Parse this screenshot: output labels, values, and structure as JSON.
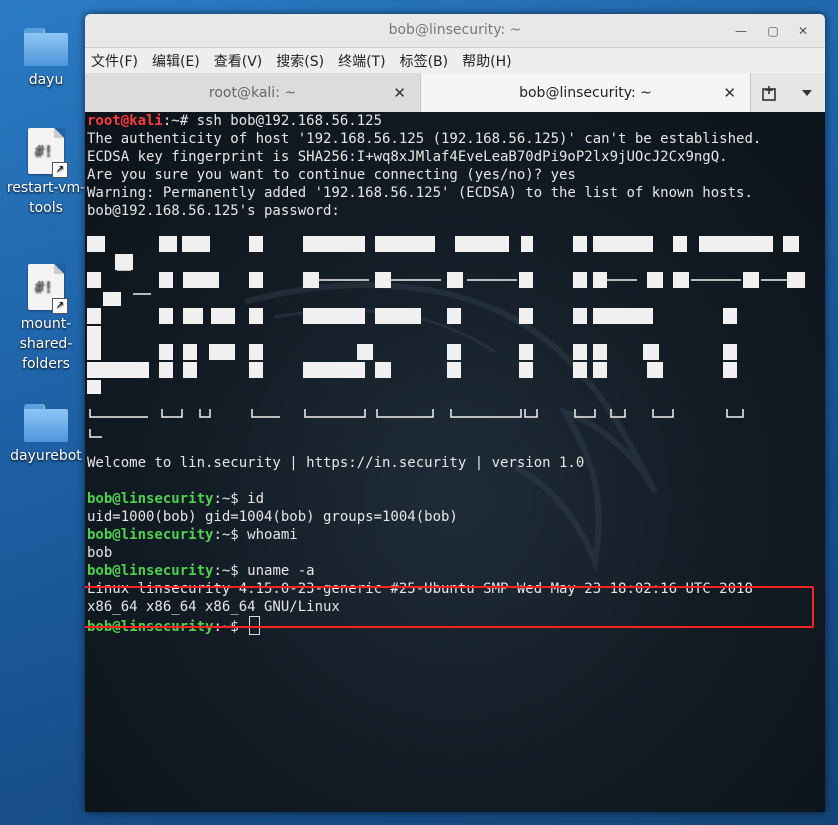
{
  "desktop": {
    "icons": [
      {
        "label": "dayu",
        "kind": "folder-icon"
      },
      {
        "label": "restart-vm-tools",
        "kind": "script-icon"
      },
      {
        "label": "mount-shared-folders",
        "kind": "script-icon"
      },
      {
        "label": "dayurebot",
        "kind": "folder-icon"
      }
    ]
  },
  "window": {
    "title": "bob@linsecurity: ~",
    "menu": [
      "文件(F)",
      "编辑(E)",
      "查看(V)",
      "搜索(S)",
      "终端(T)",
      "标签(B)",
      "帮助(H)"
    ],
    "tabs": [
      {
        "label": "root@kali: ~",
        "active": false
      },
      {
        "label": "bob@linsecurity: ~",
        "active": true
      }
    ]
  },
  "terminal": {
    "prompt1_user": "root@kali",
    "prompt1_path": ":~# ",
    "prompt1_cmd": "ssh bob@192.168.56.125",
    "out1": "The authenticity of host '192.168.56.125 (192.168.56.125)' can't be established.",
    "out2": "ECDSA key fingerprint is SHA256:I+wq8xJMlaf4EveLeaB70dPi9oP2lx9jUOcJ2Cx9ngQ.",
    "out3": "Are you sure you want to continue connecting (yes/no)? yes",
    "out4": "Warning: Permanently added '192.168.56.125' (ECDSA) to the list of known hosts.",
    "out5": "bob@192.168.56.125's password: ",
    "welcome": "Welcome to lin.security | https://in.security | version 1.0",
    "bob_user": "bob@linsecurity",
    "bob_path": ":~$ ",
    "cmd_id": "id",
    "out_id": "uid=1000(bob) gid=1004(bob) groups=1004(bob)",
    "cmd_whoami": "whoami",
    "out_whoami": "bob",
    "cmd_uname": "uname -a",
    "out_uname1": "Linux linsecurity 4.15.0-23-generic #25-Ubuntu SMP Wed May 23 18:02:16 UTC 2018",
    "out_uname2": "x86_64 x86_64 x86_64 GNU/Linux"
  },
  "colors": {
    "root_prompt": "#ff3b3b",
    "user_prompt": "#4fd14f",
    "path": "#5b8cff",
    "highlight": "#ff2020"
  }
}
